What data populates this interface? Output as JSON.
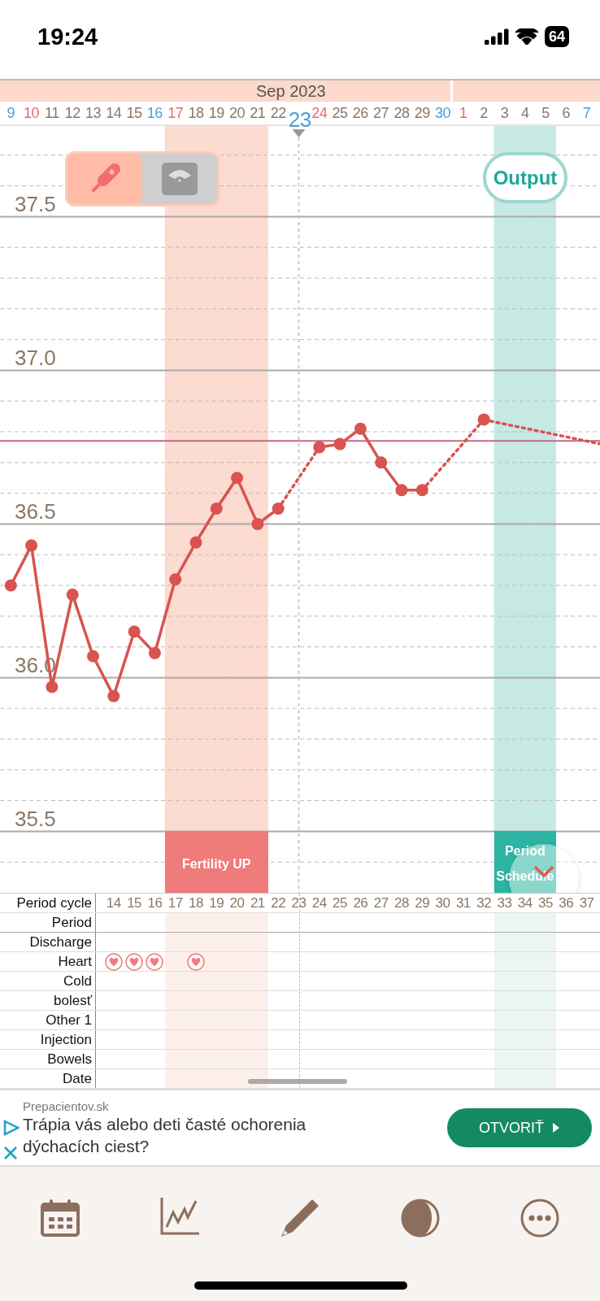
{
  "status_bar": {
    "time": "19:24",
    "battery": "64"
  },
  "date_header": {
    "month": "Sep 2023",
    "days": [
      {
        "label": "9",
        "color": "#4a9fd8",
        "selected": false,
        "kind": "plain"
      },
      {
        "label": "10",
        "color": "#e46b6b",
        "selected": false,
        "kind": "plain"
      },
      {
        "label": "11",
        "color": "#8a7766",
        "selected": false,
        "kind": "plain"
      },
      {
        "label": "12",
        "color": "#8a7766",
        "selected": false,
        "kind": "plain"
      },
      {
        "label": "13",
        "color": "#8a7766",
        "selected": false,
        "kind": "plain"
      },
      {
        "label": "14",
        "color": "#8a7766",
        "selected": false,
        "kind": "plain"
      },
      {
        "label": "15",
        "color": "#8a7766",
        "selected": false,
        "kind": "plain"
      },
      {
        "label": "16",
        "color": "#4a9fd8",
        "selected": false,
        "kind": "plain"
      },
      {
        "label": "17",
        "color": "#e46b6b",
        "selected": false,
        "kind": "fertility"
      },
      {
        "label": "18",
        "color": "#8a7766",
        "selected": false,
        "kind": "fertility"
      },
      {
        "label": "19",
        "color": "#8a7766",
        "selected": false,
        "kind": "fertility"
      },
      {
        "label": "20",
        "color": "#8a7766",
        "selected": false,
        "kind": "fertility"
      },
      {
        "label": "21",
        "color": "#8a7766",
        "selected": false,
        "kind": "fertility"
      },
      {
        "label": "22",
        "color": "#8a7766",
        "selected": false,
        "kind": "plain"
      },
      {
        "label": "23",
        "color": "#4a9fd8",
        "selected": true,
        "kind": "plain"
      },
      {
        "label": "24",
        "color": "#e46b6b",
        "selected": false,
        "kind": "plain"
      },
      {
        "label": "25",
        "color": "#8a7766",
        "selected": false,
        "kind": "plain"
      },
      {
        "label": "26",
        "color": "#8a7766",
        "selected": false,
        "kind": "plain"
      },
      {
        "label": "27",
        "color": "#8a7766",
        "selected": false,
        "kind": "plain"
      },
      {
        "label": "28",
        "color": "#8a7766",
        "selected": false,
        "kind": "plain"
      },
      {
        "label": "29",
        "color": "#8a7766",
        "selected": false,
        "kind": "plain"
      },
      {
        "label": "30",
        "color": "#4a9fd8",
        "selected": false,
        "kind": "plain"
      },
      {
        "label": "1",
        "color": "#e46b6b",
        "selected": false,
        "kind": "plain"
      },
      {
        "label": "2",
        "color": "#8a7766",
        "selected": false,
        "kind": "plain"
      },
      {
        "label": "3",
        "color": "#8a7766",
        "selected": false,
        "kind": "period"
      },
      {
        "label": "4",
        "color": "#8a7766",
        "selected": false,
        "kind": "period"
      },
      {
        "label": "5",
        "color": "#8a7766",
        "selected": false,
        "kind": "period"
      },
      {
        "label": "6",
        "color": "#8a7766",
        "selected": false,
        "kind": "plain"
      },
      {
        "label": "7",
        "color": "#4a9fd8",
        "selected": false,
        "kind": "plain"
      }
    ]
  },
  "mode_toggle": [
    {
      "kind": "thermometer",
      "selected": true
    },
    {
      "kind": "scale",
      "selected": false
    }
  ],
  "output_button": "Output",
  "chart_data": {
    "type": "line",
    "grid": true,
    "ylim": [
      35.3,
      37.8
    ],
    "yticks": [
      {
        "value": 37.5,
        "label": "37.5"
      },
      {
        "value": 37.0,
        "label": "37.0"
      },
      {
        "value": 36.5,
        "label": "36.5"
      },
      {
        "value": 36.0,
        "label": "36.0"
      },
      {
        "value": 35.5,
        "label": "35.5"
      }
    ],
    "series": [
      {
        "color": "#d9534f",
        "marker": "circle",
        "values": [
          36.3,
          36.43,
          35.97,
          36.27,
          36.07,
          35.94,
          36.15,
          36.08,
          36.32,
          36.44,
          36.55,
          36.65,
          36.5,
          36.55,
          null,
          36.75,
          36.76,
          36.81,
          36.7,
          36.61,
          36.61,
          null,
          null,
          36.84,
          null,
          null,
          null,
          null,
          null
        ]
      }
    ]
  },
  "band_labels": [
    {
      "kind": "fertility",
      "label": "Fertility UP"
    },
    {
      "kind": "period",
      "label": "Period Schedule"
    }
  ],
  "table": {
    "rows": [
      {
        "kind": "cycle",
        "label": "Period cycle",
        "cells": [
          "14",
          "15",
          "16",
          "17",
          "18",
          "19",
          "20",
          "21",
          "22",
          "23",
          "24",
          "25",
          "26",
          "27",
          "28",
          "29",
          "30",
          "31",
          "32",
          "33",
          "34",
          "35",
          "36",
          "37"
        ]
      },
      {
        "kind": "plain",
        "label": "Period"
      },
      {
        "kind": "plain",
        "label": "Discharge"
      },
      {
        "kind": "marks",
        "label": "Heart",
        "cells": [
          true,
          true,
          true,
          false,
          true
        ]
      },
      {
        "kind": "plain",
        "label": "Cold"
      },
      {
        "kind": "plain",
        "label": "bolesť"
      },
      {
        "kind": "plain",
        "label": "Other 1"
      },
      {
        "kind": "plain",
        "label": "Injection"
      },
      {
        "kind": "plain",
        "label": "Bowels"
      },
      {
        "kind": "plain",
        "label": "Date"
      }
    ]
  },
  "ad": {
    "source": "Prepacientov.sk",
    "headline": "Trápia vás alebo deti časté ochorenia dýchacích ciest?",
    "button": "OTVORIŤ"
  },
  "tab_bar": [
    {
      "kind": "calendar"
    },
    {
      "kind": "chart"
    },
    {
      "kind": "pencil"
    },
    {
      "kind": "moon"
    },
    {
      "kind": "more"
    }
  ]
}
